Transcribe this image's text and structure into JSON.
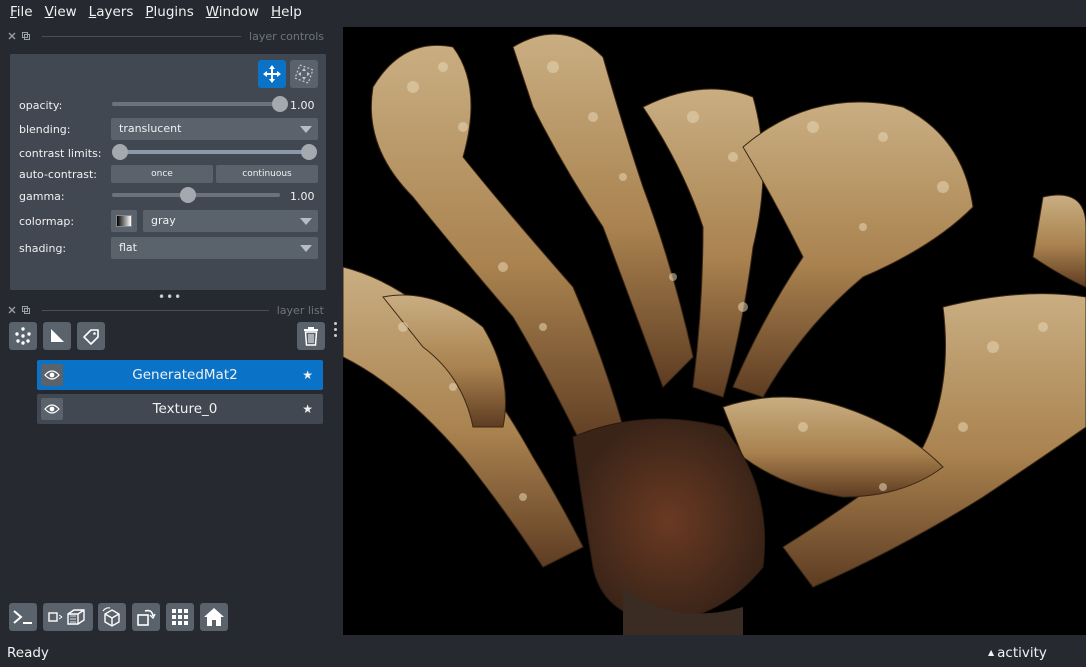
{
  "menu": {
    "file": {
      "u": "F",
      "rest": "ile"
    },
    "view": {
      "u": "V",
      "rest": "iew"
    },
    "layers": {
      "u": "L",
      "rest": "ayers"
    },
    "plugins": {
      "u": "P",
      "rest": "lugins"
    },
    "window": {
      "u": "W",
      "rest": "indow"
    },
    "help": {
      "u": "H",
      "rest": "elp"
    }
  },
  "layer_controls": {
    "title": "layer controls",
    "opacity_label": "opacity:",
    "opacity_value": "1.00",
    "opacity_fraction": 1.0,
    "blending_label": "blending:",
    "blending_value": "translucent",
    "contrast_label": "contrast limits:",
    "contrast_range": [
      0.0,
      1.0
    ],
    "autocontrast_label": "auto-contrast:",
    "once_label": "once",
    "continuous_label": "continuous",
    "gamma_label": "gamma:",
    "gamma_value": "1.00",
    "gamma_fraction": 0.45,
    "colormap_label": "colormap:",
    "colormap_value": "gray",
    "shading_label": "shading:",
    "shading_value": "flat"
  },
  "layer_list": {
    "title": "layer list",
    "layers": [
      {
        "name": "GeneratedMat2",
        "selected": true
      },
      {
        "name": "Texture_0",
        "selected": false
      }
    ]
  },
  "status": {
    "text": "Ready",
    "activity": "activity"
  },
  "colors": {
    "accent": "#0a73c8",
    "background": "#262930",
    "panel": "#414851"
  }
}
